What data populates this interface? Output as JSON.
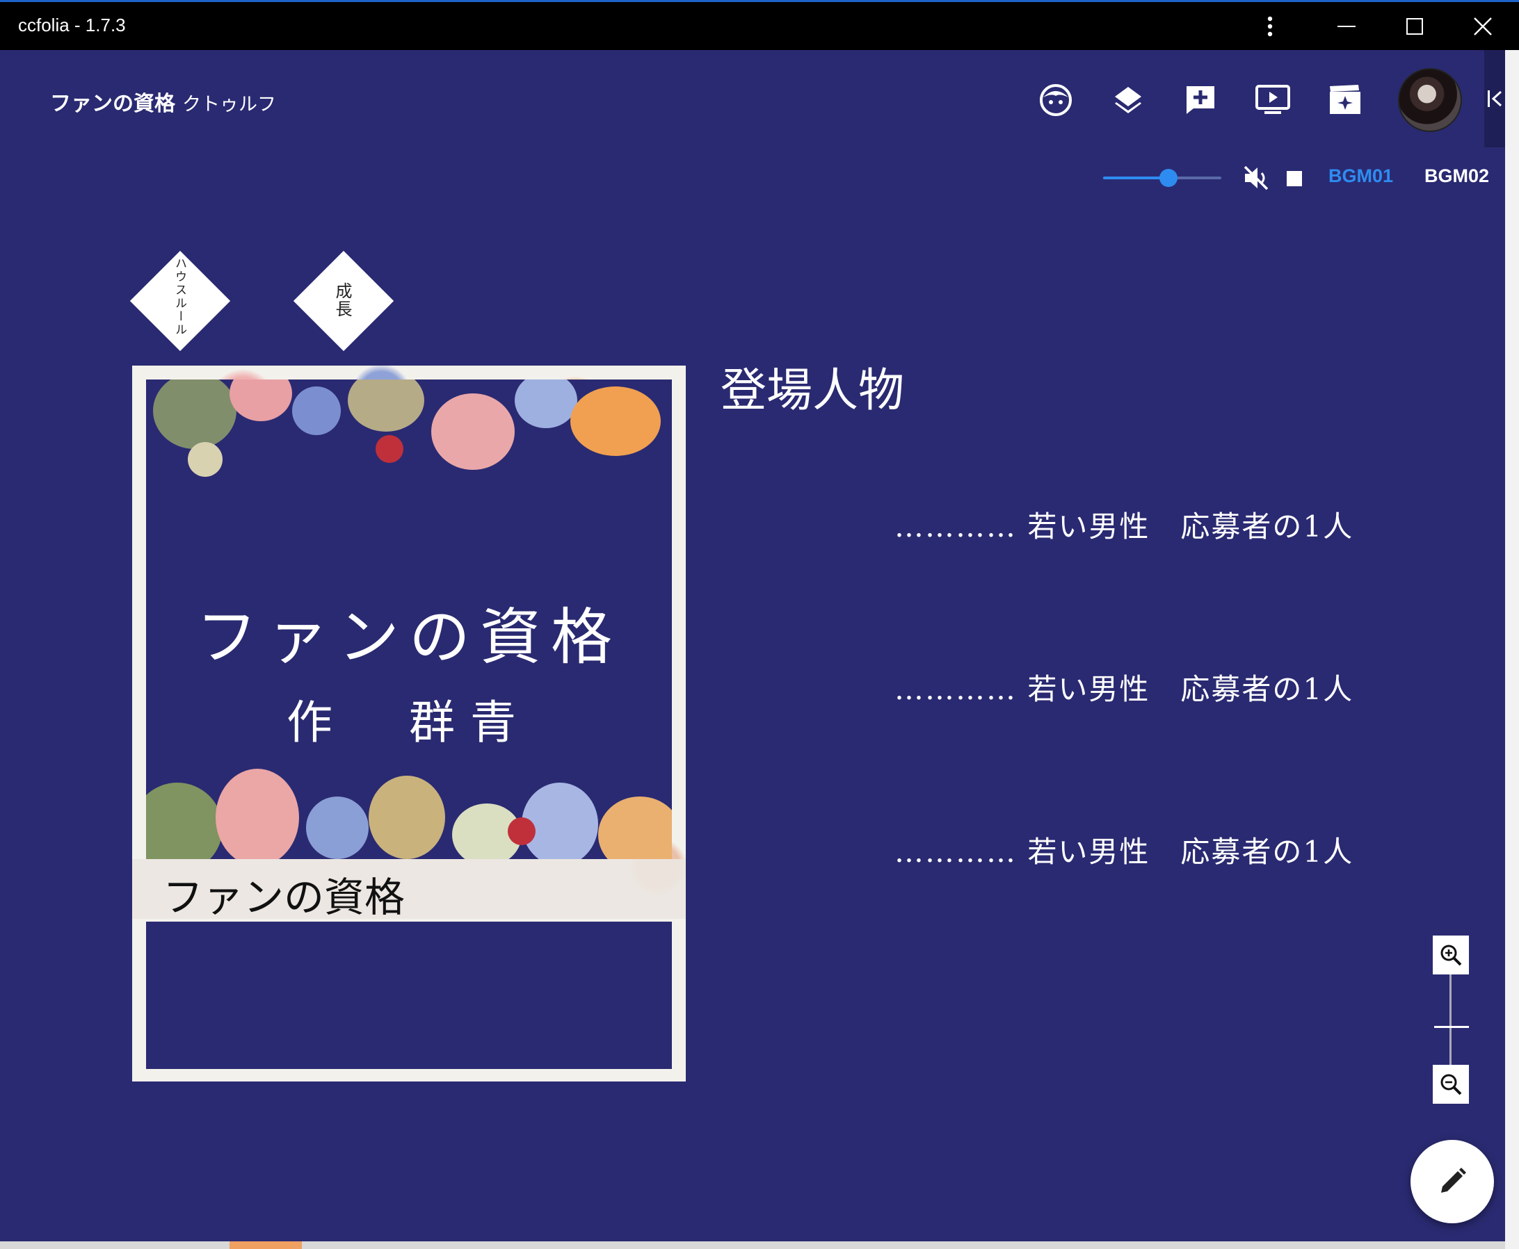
{
  "window": {
    "title": "ccfolia - 1.7.3"
  },
  "appbar": {
    "room_name": "ファンの資格",
    "game_system": "クトゥルフ"
  },
  "bgm": {
    "volume": 0.55,
    "tabs": [
      "BGM01",
      "BGM02"
    ],
    "active_tab": 0
  },
  "markers": [
    "ハウスルール",
    "成長"
  ],
  "cover": {
    "title": "ファンの資格",
    "author": "作　群青",
    "band_title": "ファンの資格"
  },
  "content": {
    "heading": "登場人物",
    "roles": [
      "………… 若い男性　応募者の1人",
      "………… 若い男性　応募者の1人",
      "………… 若い男性　応募者の1人"
    ]
  },
  "colors": {
    "background": "#2a2a72",
    "accent": "#2e8cf0",
    "titlebar": "#000000"
  },
  "icons": {
    "toolbar": [
      "character-icon",
      "layers-icon",
      "add-comment-icon",
      "screen-icon",
      "scene-icon"
    ],
    "window": [
      "more-vert-icon",
      "minimize-icon",
      "maximize-icon",
      "close-icon"
    ]
  }
}
